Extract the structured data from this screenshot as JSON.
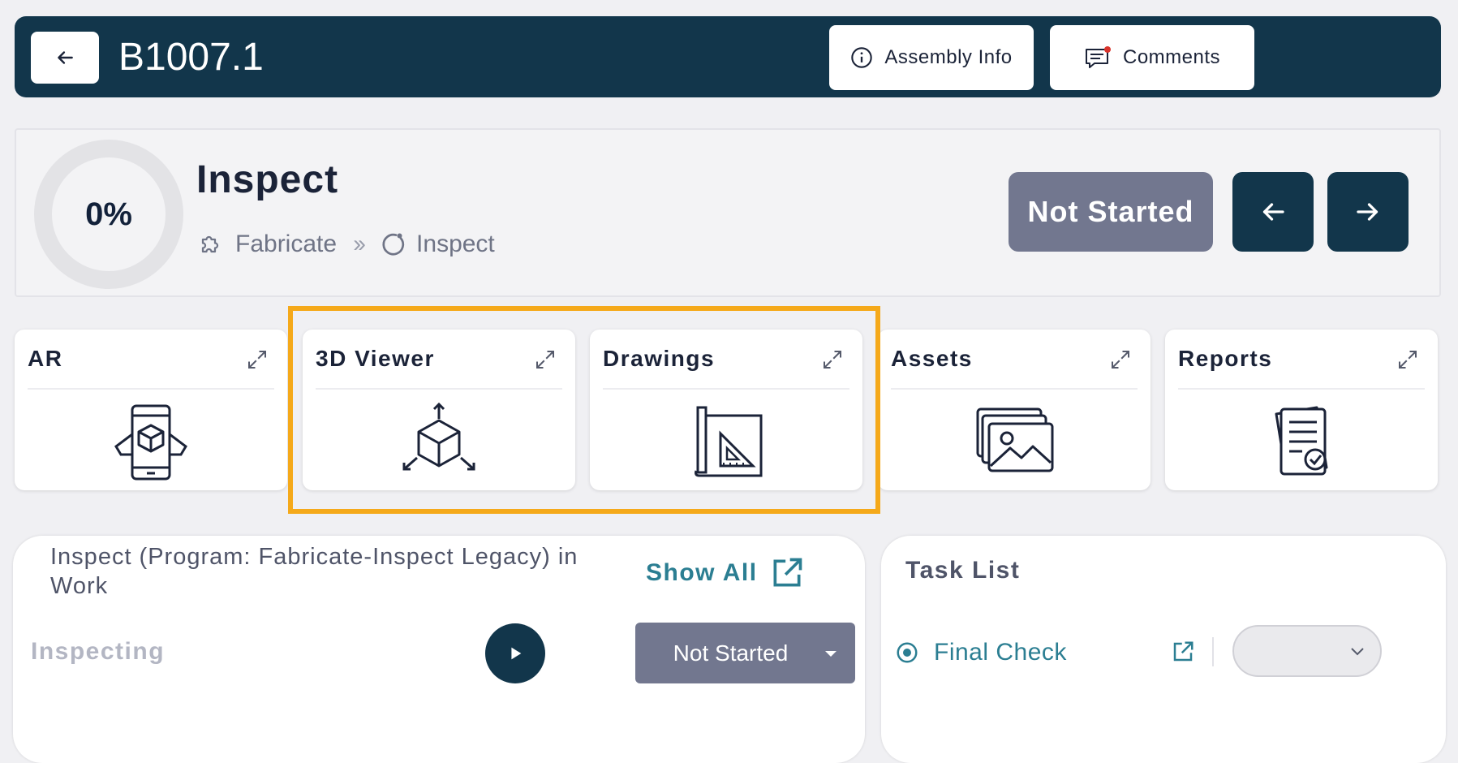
{
  "header": {
    "title": "B1007.1",
    "assembly_info_label": "Assembly Info",
    "comments_label": "Comments",
    "background_color": "#12364b"
  },
  "stage": {
    "progress_text": "0%",
    "progress_percent": 0,
    "title": "Inspect",
    "breadcrumb": [
      "Fabricate",
      "Inspect"
    ],
    "status_label": "Not Started"
  },
  "tools": [
    {
      "label": "AR",
      "icon": "ar-phone-cube-icon"
    },
    {
      "label": "3D Viewer",
      "icon": "3d-cube-icon"
    },
    {
      "label": "Drawings",
      "icon": "blueprint-icon"
    },
    {
      "label": "Assets",
      "icon": "image-stack-icon"
    },
    {
      "label": "Reports",
      "icon": "report-check-icon"
    }
  ],
  "highlight_color": "#f5a91a",
  "work": {
    "title": "Inspect (Program: Fabricate-Inspect Legacy) in Work",
    "show_all_label": "Show All",
    "activity_label": "Inspecting",
    "status_value": "Not Started"
  },
  "task_list": {
    "title": "Task List",
    "items": [
      {
        "label": "Final Check",
        "selected_value": ""
      }
    ]
  },
  "colors": {
    "accent": "#2b7e92",
    "status_gray": "#72778f",
    "navy": "#12364b"
  }
}
